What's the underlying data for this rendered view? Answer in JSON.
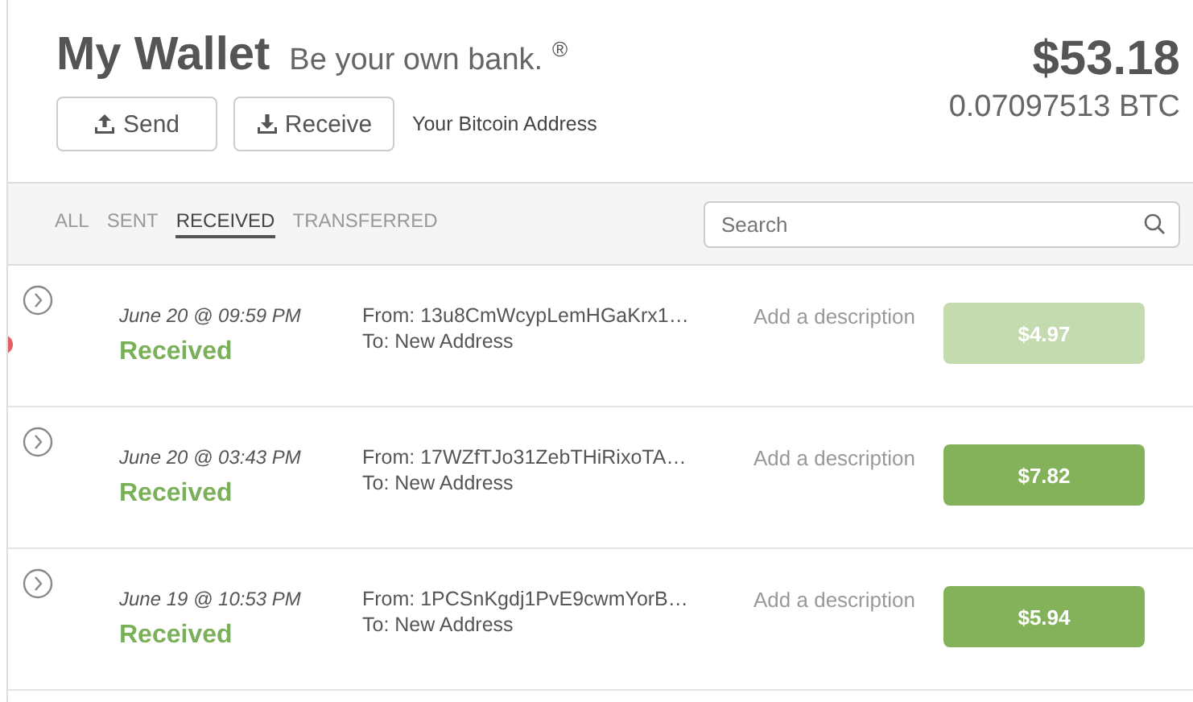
{
  "header": {
    "title": "My Wallet",
    "tagline": "Be your own bank.",
    "registered": "®",
    "balance_usd": "$53.18",
    "balance_btc": "0.07097513 BTC"
  },
  "actions": [
    {
      "label": "Send",
      "kind": "send"
    },
    {
      "label": "Receive",
      "kind": "receive"
    }
  ],
  "address_link": "Your Bitcoin Address",
  "filters": [
    {
      "label": "ALL",
      "selected": false
    },
    {
      "label": "SENT",
      "selected": false
    },
    {
      "label": "RECEIVED",
      "selected": true
    },
    {
      "label": "TRANSFERRED",
      "selected": false
    }
  ],
  "search": {
    "placeholder": "Search"
  },
  "transactions": [
    {
      "date": "June 20 @ 09:59 PM",
      "status": "Received",
      "from": "From: 13u8CmWcypLemHGaKrx1…",
      "to": "To: New Address",
      "description": "Add a description",
      "amount": "$4.97",
      "faded": true,
      "flagged": true
    },
    {
      "date": "June 20 @ 03:43 PM",
      "status": "Received",
      "from": "From: 17WZfTJo31ZebTHiRixoTA…",
      "to": "To: New Address",
      "description": "Add a description",
      "amount": "$7.82",
      "faded": false,
      "flagged": false
    },
    {
      "date": "June 19 @ 10:53 PM",
      "status": "Received",
      "from": "From: 1PCSnKgdj1PvE9cwmYorB…",
      "to": "To: New Address",
      "description": "Add a description",
      "amount": "$5.94",
      "faded": false,
      "flagged": false
    }
  ]
}
